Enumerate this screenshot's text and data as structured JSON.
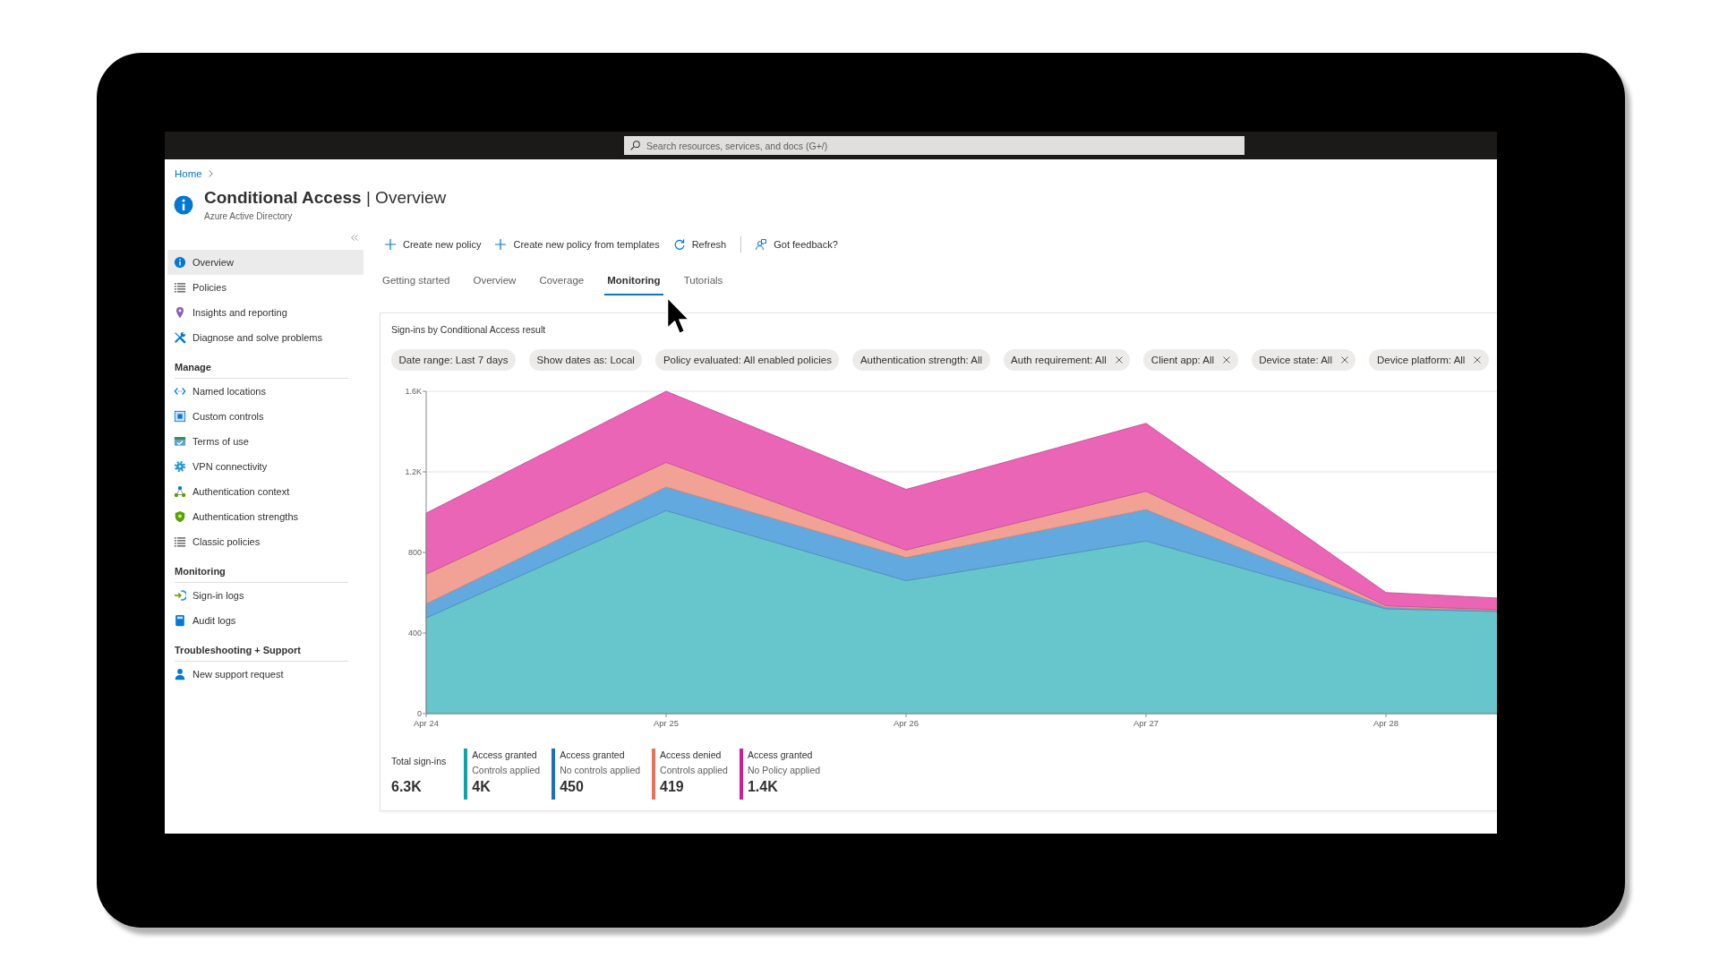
{
  "top_bar": {
    "search": {
      "placeholder": "Search resources, services, and docs (G+/)"
    }
  },
  "breadcrumb": [
    "Home"
  ],
  "header": {
    "title": "**Conditional Access** | Overview",
    "subtitle": "Azure Active Directory"
  },
  "sidebar": {
    "items": [
      {
        "label": "Overview",
        "selected": true
      },
      {
        "label": "Policies",
        "selected": false
      },
      {
        "label": "Insights and reporting",
        "selected": false
      },
      {
        "label": "Diagnose and solve problems",
        "selected": false
      }
    ],
    "sections": [
      {
        "heading": "Manage",
        "items": [
          {
            "label": "Named locations",
            "selected": false
          },
          {
            "label": "Custom controls",
            "selected": false
          },
          {
            "label": "Terms of use",
            "selected": false
          },
          {
            "label": "VPN connectivity",
            "selected": false
          },
          {
            "label": "Authentication context",
            "selected": false
          },
          {
            "label": "Authentication strengths",
            "selected": false
          },
          {
            "label": "Classic policies",
            "selected": false
          }
        ]
      },
      {
        "heading": "Monitoring",
        "items": [
          {
            "label": "Sign-in logs",
            "selected": false
          },
          {
            "label": "Audit logs",
            "selected": false
          }
        ]
      },
      {
        "heading": "Troubleshooting + Support",
        "items": [
          {
            "label": "New support request",
            "selected": false
          }
        ]
      }
    ]
  },
  "toolbar": [
    {
      "label": "Create new policy"
    },
    {
      "label": "Create new policy from templates"
    },
    {
      "label": "Refresh"
    },
    {
      "label": "Got feedback?"
    }
  ],
  "tabs": [
    {
      "label": "Getting started",
      "selected": false
    },
    {
      "label": "Overview",
      "selected": false
    },
    {
      "label": "Coverage",
      "selected": false
    },
    {
      "label": "Monitoring",
      "selected": true
    },
    {
      "label": "Tutorials",
      "selected": false
    }
  ],
  "card": {
    "title": "Sign-ins by Conditional Access result",
    "filters": [
      {
        "label": "Date range: Last 7 days",
        "removable": false
      },
      {
        "label": "Show dates as: Local",
        "removable": false
      },
      {
        "label": "Policy evaluated: All enabled policies",
        "removable": false
      },
      {
        "label": "Authentication strength: All",
        "removable": false
      },
      {
        "label": "Auth requirement: All",
        "removable": true
      },
      {
        "label": "Client app: All",
        "removable": true
      },
      {
        "label": "Device state: All",
        "removable": true
      },
      {
        "label": "Device platform: All",
        "removable": true
      }
    ],
    "chart_data": {
      "type": "area",
      "stacked": true,
      "categories": [
        "Apr 24",
        "Apr 25",
        "Apr 26",
        "Apr 27",
        "Apr 28",
        null
      ],
      "ylim": [
        0,
        1600
      ],
      "yticks": [
        0,
        400,
        800,
        {
          "value": 1200,
          "label": "1.2K"
        },
        {
          "value": 1600,
          "label": "1.6K"
        }
      ],
      "series": [
        {
          "color": "#66c6cc",
          "values": [
            475,
            1008,
            660,
            857,
            520,
            492
          ]
        },
        {
          "color": "#62a9e0",
          "values": [
            70,
            117,
            115,
            156,
            7,
            3
          ]
        },
        {
          "color": "#f2a294",
          "values": [
            147,
            122,
            37,
            91,
            8,
            0
          ]
        },
        {
          "color": "#ea65b6",
          "values": [
            303,
            353,
            301,
            337,
            66,
            47
          ]
        }
      ]
    },
    "summary": {
      "total": {
        "label": "Total sign-ins",
        "value": "6.3K"
      },
      "items": [
        {
          "label": "Access granted",
          "detail": "Controls applied",
          "value": "4K",
          "color": "#14a2a9"
        },
        {
          "label": "Access granted",
          "detail": "No controls applied",
          "value": "450",
          "color": "#1b6ec2"
        },
        {
          "label": "Access denied",
          "detail": "Controls applied",
          "value": "419",
          "color": "#e8735c"
        },
        {
          "label": "Access granted",
          "detail": "No Policy applied",
          "value": "1.4K",
          "color": "#d41c8f"
        }
      ]
    }
  }
}
